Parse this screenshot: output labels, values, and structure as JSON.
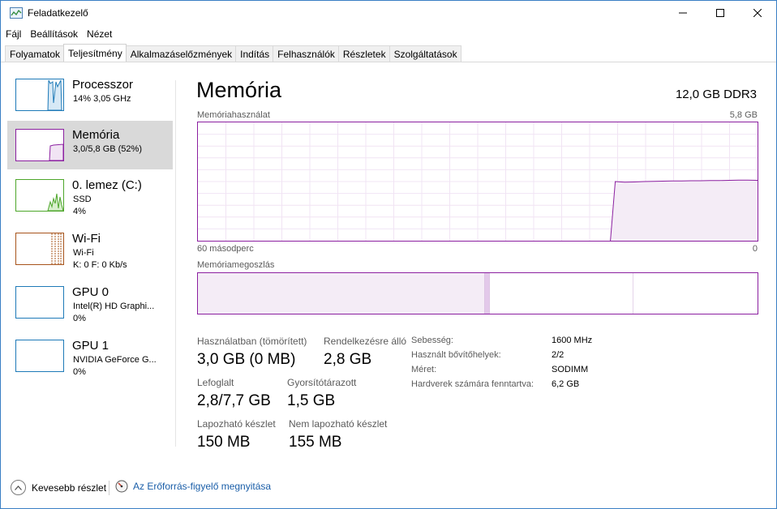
{
  "window": {
    "title": "Feladatkezelő",
    "controls": {
      "minimize": "minimize",
      "maximize": "maximize",
      "close": "close"
    }
  },
  "menu": [
    "Fájl",
    "Beállítások",
    "Nézet"
  ],
  "tabs": [
    {
      "label": "Folyamatok",
      "active": false
    },
    {
      "label": "Teljesítmény",
      "active": true
    },
    {
      "label": "Alkalmazáselőzmények",
      "active": false
    },
    {
      "label": "Indítás",
      "active": false
    },
    {
      "label": "Felhasználók",
      "active": false
    },
    {
      "label": "Részletek",
      "active": false
    },
    {
      "label": "Szolgáltatások",
      "active": false
    }
  ],
  "sidebar": {
    "items": [
      {
        "title": "Processzor",
        "lines": [
          "14%  3,05 GHz"
        ],
        "color": "#1e7ab8",
        "selected": false
      },
      {
        "title": "Memória",
        "lines": [
          "3,0/5,8 GB (52%)"
        ],
        "color": "#8b1fa0",
        "selected": true
      },
      {
        "title": "0. lemez (C:)",
        "lines": [
          "SSD",
          "4%"
        ],
        "color": "#4da62a",
        "selected": false
      },
      {
        "title": "Wi-Fi",
        "lines": [
          "Wi-Fi",
          "K: 0  F: 0 Kb/s"
        ],
        "color": "#a7541b",
        "selected": false
      },
      {
        "title": "GPU 0",
        "lines": [
          "Intel(R) HD Graphi...",
          "0%"
        ],
        "color": "#1e7ab8",
        "selected": false
      },
      {
        "title": "GPU 1",
        "lines": [
          "NVIDIA GeForce G...",
          "0%"
        ],
        "color": "#1e7ab8",
        "selected": false
      }
    ]
  },
  "main": {
    "title": "Memória",
    "spec": "12,0 GB DDR3",
    "graph": {
      "label": "Memóriahasználat",
      "max_label": "5,8 GB",
      "x_left_label": "60 másodperc",
      "x_right_label": "0",
      "color": "#8b1fa0",
      "usage_series_gb": [
        0,
        0,
        0,
        0,
        0,
        0,
        0,
        0,
        0,
        0,
        0,
        0,
        0,
        0,
        0,
        0,
        0,
        0,
        0,
        0,
        0,
        0,
        0,
        0,
        0,
        0,
        0,
        0,
        0,
        0,
        0,
        0,
        0,
        0,
        0,
        0,
        0,
        0,
        0,
        0,
        0,
        0,
        0,
        0,
        2.9,
        2.87,
        2.88,
        2.9,
        2.91,
        2.92,
        2.93,
        2.93,
        2.94,
        2.94,
        2.95,
        2.95,
        2.96,
        2.97,
        2.97,
        2.96
      ],
      "max_gb": 5.8
    },
    "composition": {
      "label": "Memóriamegoszlás",
      "segments_gb": {
        "in_use": 3.0,
        "modified": 0.05,
        "standby": 1.5,
        "free": 1.3
      }
    },
    "stats": {
      "in_use_label": "Használatban (tömörített)",
      "in_use_value": "3,0 GB (0 MB)",
      "available_label": "Rendelkezésre álló",
      "available_value": "2,8 GB",
      "committed_label": "Lefoglalt",
      "committed_value": "2,8/7,7 GB",
      "cached_label": "Gyorsítótárazott",
      "cached_value": "1,5 GB",
      "paged_label": "Lapozható készlet",
      "paged_value": "150 MB",
      "nonpaged_label": "Nem lapozható készlet",
      "nonpaged_value": "155 MB"
    },
    "details": [
      {
        "label": "Sebesség:",
        "value": "1600 MHz"
      },
      {
        "label": "Használt bővítőhelyek:",
        "value": "2/2"
      },
      {
        "label": "Méret:",
        "value": "SODIMM"
      },
      {
        "label": "Hardverek számára fenntartva:",
        "value": "6,2 GB"
      }
    ]
  },
  "footer": {
    "fewer_details": "Kevesebb részlet",
    "resource_monitor": "Az Erőforrás-figyelő megnyitása"
  }
}
